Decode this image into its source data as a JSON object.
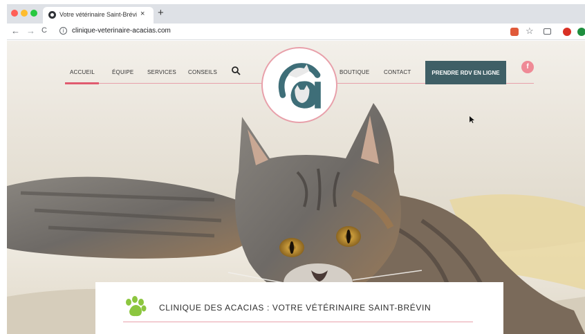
{
  "browser": {
    "tab_title": "Votre vétérinaire Saint-Brévin",
    "tab_close": "×",
    "new_tab": "+",
    "nav": {
      "back": "←",
      "forward": "→",
      "reload": "C"
    },
    "url": "clinique-veterinaire-acacias.com",
    "star": "☆"
  },
  "site": {
    "nav_left": [
      {
        "label": "ACCUEIL",
        "active": true
      },
      {
        "label": "ÉQUIPE"
      },
      {
        "label": "SERVICES"
      },
      {
        "label": "CONSEILS"
      }
    ],
    "nav_right": [
      {
        "label": "BOUTIQUE"
      },
      {
        "label": "CONTACT"
      }
    ],
    "cta": "PRENDRE RDV EN LIGNE",
    "facebook": "f",
    "card_title": "CLINIQUE DES ACACIAS : VOTRE VÉTÉRINAIRE SAINT-BRÉVIN"
  },
  "colors": {
    "accent_pink": "#e8a0aa",
    "active_red": "#e05a6f",
    "cta_bg": "#3f5f66",
    "teal": "#3e6e78",
    "paw_green": "#8cc63f"
  }
}
